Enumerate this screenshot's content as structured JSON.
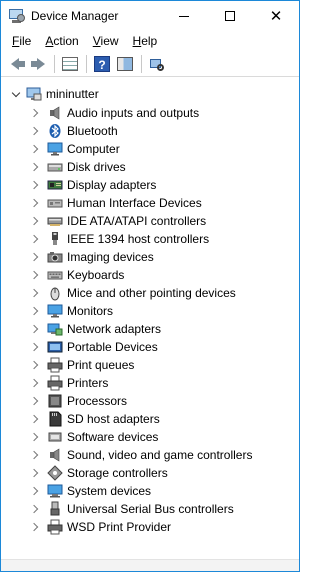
{
  "window": {
    "title": "Device Manager"
  },
  "window_controls": {
    "minimize": "—",
    "maximize": "☐",
    "close": "✕"
  },
  "menubar": [
    {
      "label": "File",
      "mnemonic": "F",
      "rest": "ile"
    },
    {
      "label": "Action",
      "mnemonic": "A",
      "rest": "ction"
    },
    {
      "label": "View",
      "mnemonic": "V",
      "rest": "iew"
    },
    {
      "label": "Help",
      "mnemonic": "H",
      "rest": "elp"
    }
  ],
  "toolbar": {
    "buttons": [
      "back-icon",
      "forward-icon",
      "properties-grid-icon",
      "help-icon",
      "show-hide-pane-icon",
      "scan-hardware-icon"
    ]
  },
  "tree": {
    "root": {
      "label": "mininutter",
      "icon": "computer-icon",
      "expanded": true
    },
    "items": [
      {
        "label": "Audio inputs and outputs",
        "icon": "speaker-icon"
      },
      {
        "label": "Bluetooth",
        "icon": "bluetooth-icon"
      },
      {
        "label": "Computer",
        "icon": "monitor-icon"
      },
      {
        "label": "Disk drives",
        "icon": "disk-drive-icon"
      },
      {
        "label": "Display adapters",
        "icon": "display-adapter-icon"
      },
      {
        "label": "Human Interface Devices",
        "icon": "hid-icon"
      },
      {
        "label": "IDE ATA/ATAPI controllers",
        "icon": "ide-controller-icon"
      },
      {
        "label": "IEEE 1394 host controllers",
        "icon": "firewire-icon"
      },
      {
        "label": "Imaging devices",
        "icon": "camera-icon"
      },
      {
        "label": "Keyboards",
        "icon": "keyboard-icon"
      },
      {
        "label": "Mice and other pointing devices",
        "icon": "mouse-icon"
      },
      {
        "label": "Monitors",
        "icon": "monitor-icon"
      },
      {
        "label": "Network adapters",
        "icon": "network-adapter-icon"
      },
      {
        "label": "Portable Devices",
        "icon": "portable-device-icon"
      },
      {
        "label": "Print queues",
        "icon": "printer-icon"
      },
      {
        "label": "Printers",
        "icon": "printer-icon"
      },
      {
        "label": "Processors",
        "icon": "processor-icon"
      },
      {
        "label": "SD host adapters",
        "icon": "sd-card-icon"
      },
      {
        "label": "Software devices",
        "icon": "software-device-icon"
      },
      {
        "label": "Sound, video and game controllers",
        "icon": "speaker-icon"
      },
      {
        "label": "Storage controllers",
        "icon": "storage-controller-icon"
      },
      {
        "label": "System devices",
        "icon": "system-device-icon"
      },
      {
        "label": "Universal Serial Bus controllers",
        "icon": "usb-icon"
      },
      {
        "label": "WSD Print Provider",
        "icon": "printer-icon"
      }
    ]
  },
  "colors": {
    "border": "#1c88d8",
    "accent": "#2c5db0"
  }
}
